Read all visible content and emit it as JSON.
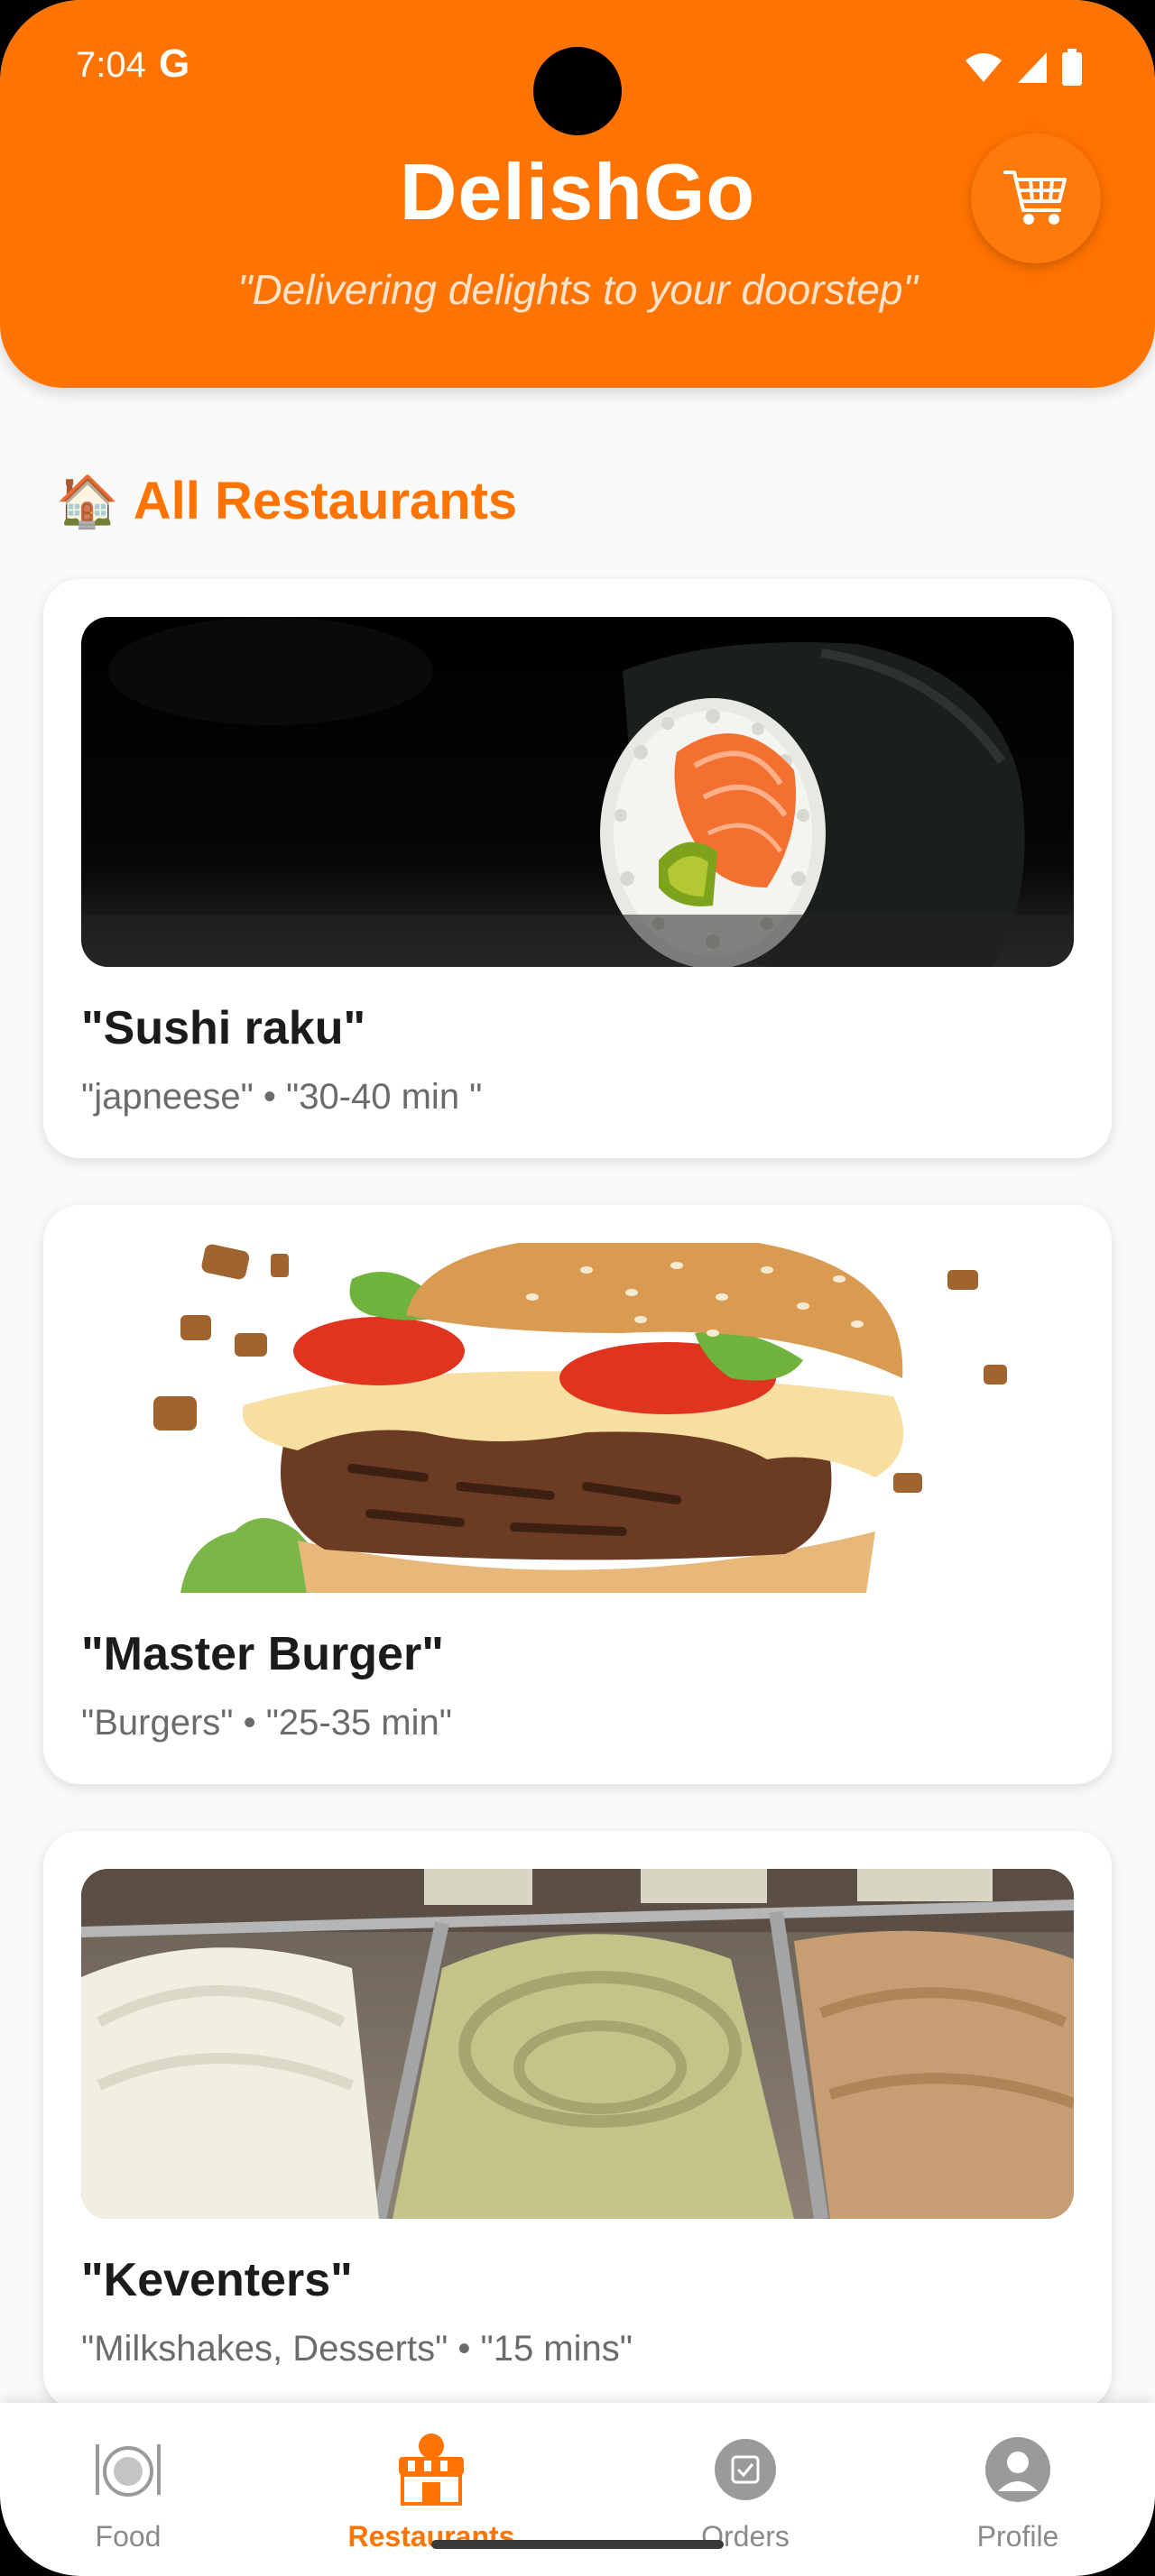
{
  "status_bar": {
    "time": "7:04",
    "google_glyph": "G"
  },
  "header": {
    "title": "DelishGo",
    "tagline": "\"Delivering delights to your doorstep\"",
    "cart_icon": "cart-icon"
  },
  "section": {
    "emoji": "🏠",
    "title": "All Restaurants"
  },
  "restaurants": [
    {
      "name": "\"Sushi raku\"",
      "cuisine": "\"japneese\"",
      "time": "\"30-40 min \"",
      "meta": "\"japneese\" • \"30-40 min \"",
      "image": "sushi-roll"
    },
    {
      "name": "\"Master Burger\"",
      "cuisine": "\"Burgers\"",
      "time": "\"25-35 min\"",
      "meta": "\"Burgers\" • \"25-35 min\"",
      "image": "burger"
    },
    {
      "name": "\"Keventers\"",
      "cuisine": "\"Milkshakes, Desserts\"",
      "time": "\"15 mins\"",
      "meta": "\"Milkshakes, Desserts\" • \"15 mins\"",
      "image": "ice-cream-trays"
    }
  ],
  "bottom_nav": {
    "items": [
      {
        "label": "Food",
        "icon": "food-plate-icon",
        "active": false
      },
      {
        "label": "Restaurants",
        "icon": "storefront-icon",
        "active": true
      },
      {
        "label": "Orders",
        "icon": "orders-icon",
        "active": false
      },
      {
        "label": "Profile",
        "icon": "profile-icon",
        "active": false
      }
    ]
  },
  "colors": {
    "accent": "#ff7300",
    "background": "#fafafa",
    "card": "#ffffff",
    "nav_inactive": "#8a8a8a"
  }
}
